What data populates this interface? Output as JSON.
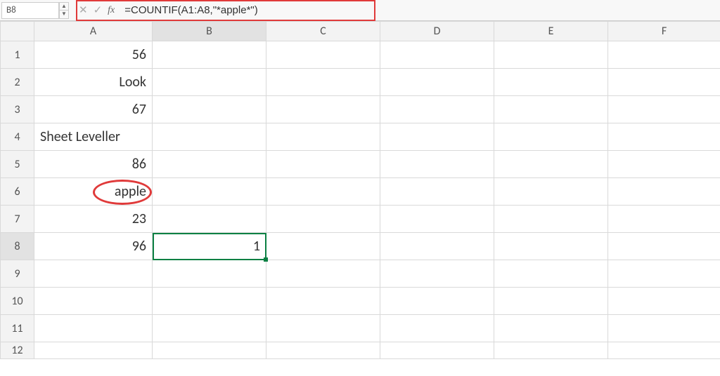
{
  "formula_bar": {
    "cell_ref": "B8",
    "fx_label": "fx",
    "formula": "=COUNTIF(A1:A8,\"*apple*\")",
    "cancel_icon": "✕",
    "confirm_icon": "✓",
    "stepper_up": "▲",
    "stepper_down": "▼"
  },
  "columns": [
    "A",
    "B",
    "C",
    "D",
    "E",
    "F"
  ],
  "rows": [
    {
      "n": "1",
      "A": "56"
    },
    {
      "n": "2",
      "A": "Look"
    },
    {
      "n": "3",
      "A": "67"
    },
    {
      "n": "4",
      "A": "Sheet Leveller"
    },
    {
      "n": "5",
      "A": "86"
    },
    {
      "n": "6",
      "A": "apple"
    },
    {
      "n": "7",
      "A": "23"
    },
    {
      "n": "8",
      "A": "96",
      "B": "1"
    },
    {
      "n": "9"
    },
    {
      "n": "10"
    },
    {
      "n": "11"
    },
    {
      "n": "12"
    }
  ],
  "selected": {
    "row": "8",
    "col": "B"
  },
  "circled": {
    "row": "6",
    "col": "A"
  }
}
